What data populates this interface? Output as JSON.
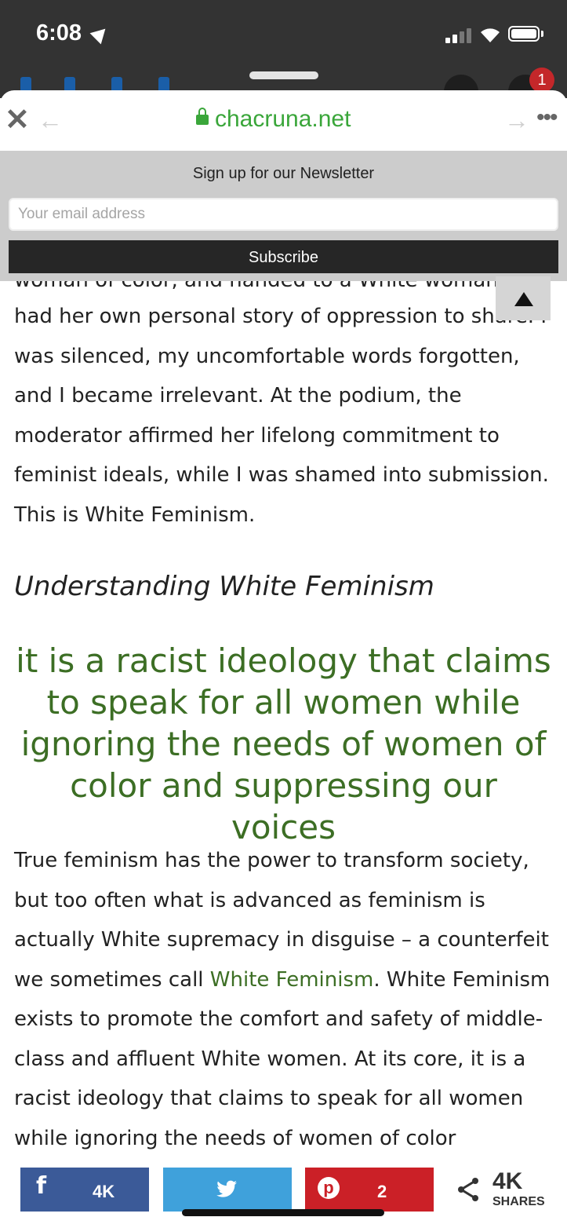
{
  "status": {
    "time": "6:08",
    "notification_count": "1"
  },
  "browser": {
    "url": "chacruna.net"
  },
  "newsletter": {
    "title": "Sign up for our Newsletter",
    "email_placeholder": "Your email address",
    "subscribe_label": "Subscribe"
  },
  "article": {
    "cut_line": "woman of color, and handed to a White woman who",
    "para1": "had her own personal story of oppression to share. I was silenced, my uncomfortable words forgotten, and I became irrelevant. At the podium, the moderator affirmed her lifelong commitment to feminist ideals, while I was shamed into submission. This is White Feminism.",
    "heading": "Understanding White Feminism",
    "pull_quote": "it is a racist ideology that claims to speak for all women while ignoring the needs of women of color and suppressing our voices",
    "para2_before_link": "True feminism has the power to transform society, but too often what is advanced as feminism is actually White supremacy in disguise – a counterfeit we sometimes call ",
    "para2_link": "White Feminism",
    "para2_after_link": ".  White Feminism exists to promote the comfort and safety of middle-class and affluent White women. At its core, it is a racist ideology that claims to speak for all women while ignoring the needs of women of color"
  },
  "share": {
    "facebook_count": "4K",
    "pinterest_count": "2",
    "total_count": "4K",
    "total_label": "SHARES",
    "colors": {
      "facebook": "#3b5a98",
      "twitter": "#3fa1db",
      "pinterest": "#cb2027"
    }
  },
  "colors": {
    "link_green": "#3c6e24",
    "url_green": "#3aa63a"
  }
}
